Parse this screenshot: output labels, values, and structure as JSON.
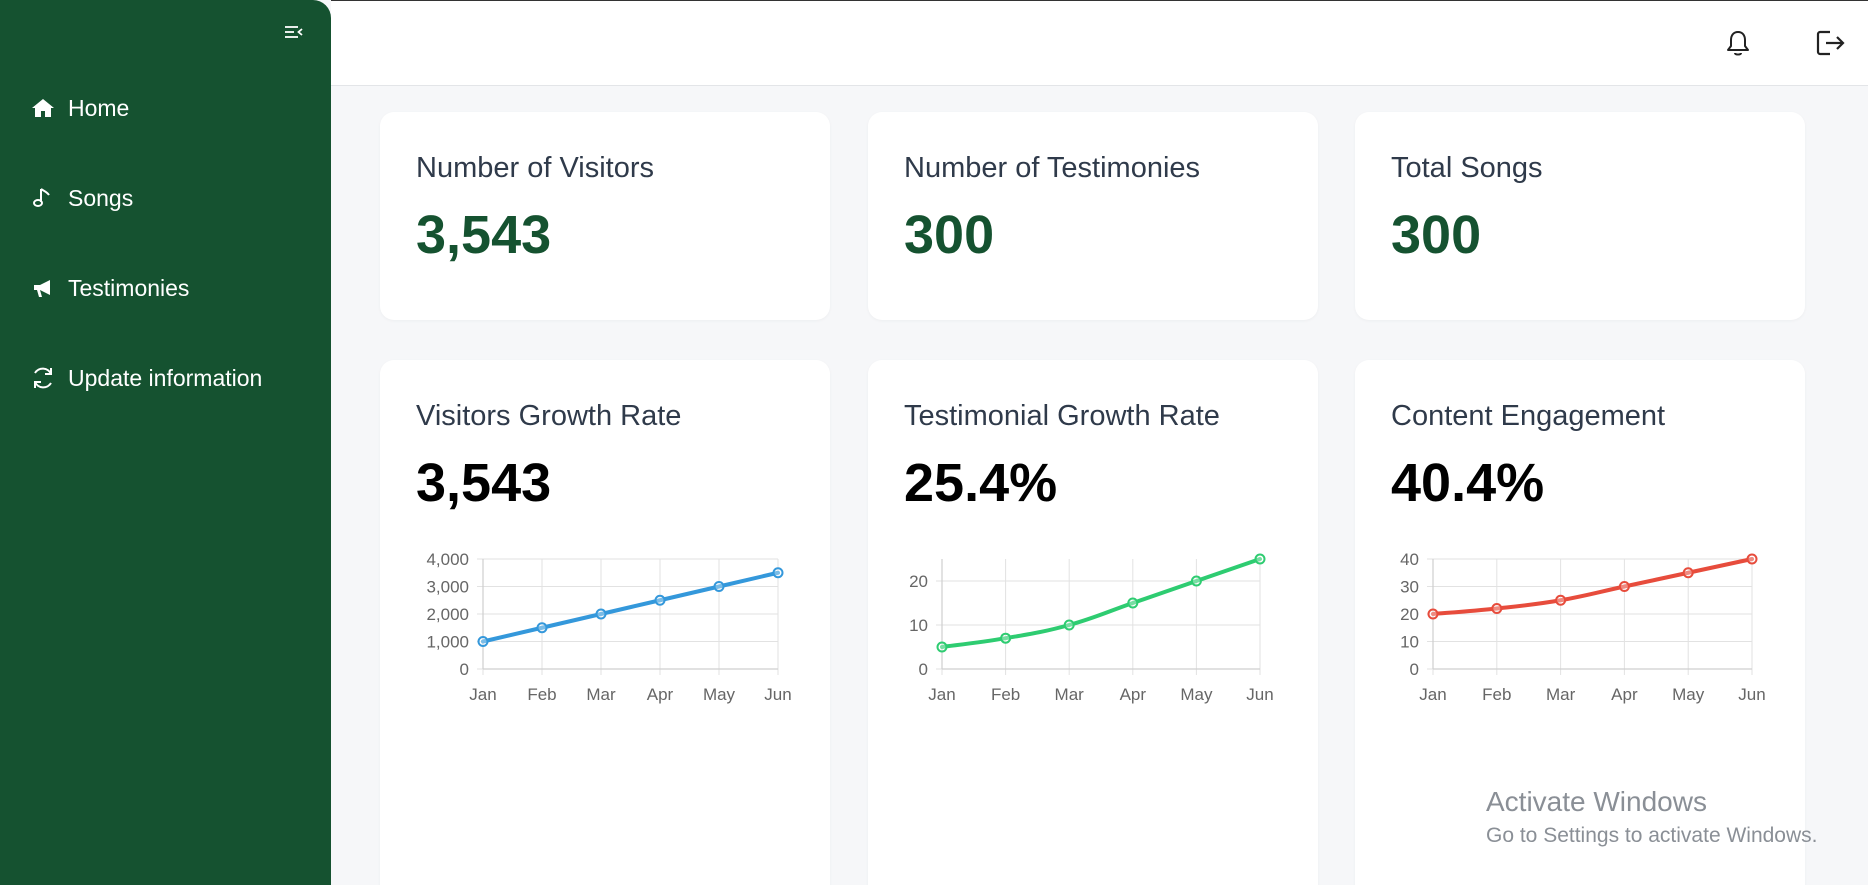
{
  "sidebar": {
    "collapse_icon": "menu-collapse-icon",
    "items": [
      {
        "label": "Home",
        "icon": "home-icon"
      },
      {
        "label": "Songs",
        "icon": "music-note-icon"
      },
      {
        "label": "Testimonies",
        "icon": "megaphone-icon"
      },
      {
        "label": "Update information",
        "icon": "refresh-icon"
      }
    ]
  },
  "topbar": {
    "notification_icon": "bell-icon",
    "logout_icon": "logout-icon"
  },
  "stats": [
    {
      "title": "Number of Visitors",
      "value": "3,543"
    },
    {
      "title": "Number of Testimonies",
      "value": "300"
    },
    {
      "title": "Total Songs",
      "value": "300"
    }
  ],
  "metrics": [
    {
      "title": "Visitors Growth Rate",
      "value": "3,543"
    },
    {
      "title": "Testimonial Growth Rate",
      "value": "25.4%"
    },
    {
      "title": "Content Engagement",
      "value": "40.4%"
    }
  ],
  "chart_data": [
    {
      "type": "line",
      "x": [
        "Jan",
        "Feb",
        "Mar",
        "Apr",
        "May",
        "Jun"
      ],
      "series": [
        {
          "values": [
            1000,
            1500,
            2000,
            2500,
            3000,
            3500
          ]
        }
      ],
      "ylim": [
        0,
        4000
      ],
      "yticks": [
        0,
        1000,
        2000,
        3000,
        4000
      ],
      "ytick_labels": [
        "0",
        "1,000",
        "2,000",
        "3,000",
        "4,000"
      ],
      "color": "#3498db",
      "grid": true
    },
    {
      "type": "line",
      "x": [
        "Jan",
        "Feb",
        "Mar",
        "Apr",
        "May",
        "Jun"
      ],
      "series": [
        {
          "values": [
            5,
            7,
            10,
            15,
            20,
            25
          ]
        }
      ],
      "ylim": [
        0,
        25
      ],
      "yticks": [
        0,
        10,
        20
      ],
      "ytick_labels": [
        "0",
        "10",
        "20"
      ],
      "color": "#2ecc71",
      "grid": true
    },
    {
      "type": "line",
      "x": [
        "Jan",
        "Feb",
        "Mar",
        "Apr",
        "May",
        "Jun"
      ],
      "series": [
        {
          "values": [
            20,
            22,
            25,
            30,
            35,
            40
          ]
        }
      ],
      "ylim": [
        0,
        40
      ],
      "yticks": [
        0,
        10,
        20,
        30,
        40
      ],
      "ytick_labels": [
        "0",
        "10",
        "20",
        "30",
        "40"
      ],
      "color": "#e74c3c",
      "grid": true
    }
  ],
  "watermark": {
    "line1": "Activate Windows",
    "line2": "Go to Settings to activate Windows."
  }
}
